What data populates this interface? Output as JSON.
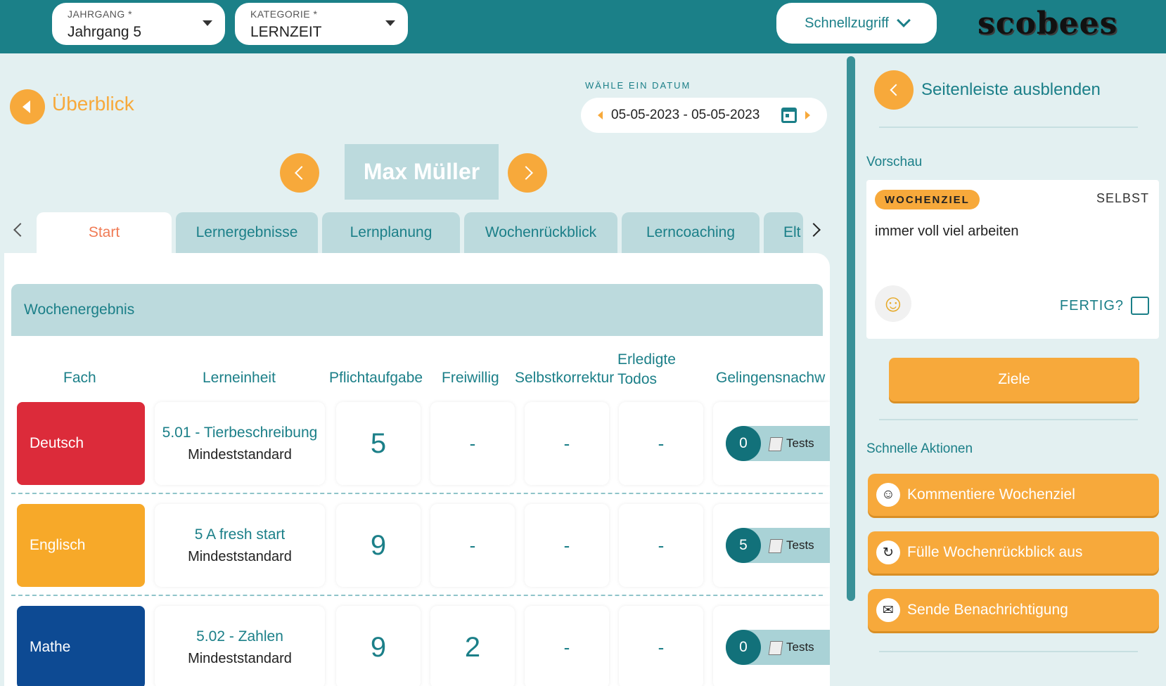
{
  "header": {
    "jahrgang": {
      "label": "JAHRGANG *",
      "value": "Jahrgang 5"
    },
    "kategorie": {
      "label": "KATEGORIE *",
      "value": "LERNZEIT"
    },
    "quick_access": "Schnellzugriff",
    "logo": "scobees"
  },
  "main": {
    "back_label": "Überblick",
    "date_label": "WÄHLE EIN DATUM",
    "date_range": "05-05-2023 - 05-05-2023",
    "student_name": "Max Müller",
    "tabs": [
      {
        "label": "Start",
        "active": true
      },
      {
        "label": "Lernergebnisse"
      },
      {
        "label": "Lernplanung"
      },
      {
        "label": "Wochenrückblick"
      },
      {
        "label": "Lerncoaching"
      },
      {
        "label": "Elt"
      }
    ],
    "section_title": "Wochenergebnis",
    "columns": [
      "Fach",
      "Lerneinheit",
      "Pflichtaufgabe",
      "Freiwillig",
      "Selbstkorrektur",
      "Erledigte Todos",
      "Gelingensnachw"
    ],
    "rows": [
      {
        "subject": "Deutsch",
        "color": "#dc2b3a",
        "unit_title": "5.01 - Tierbeschreibung",
        "unit_standard": "Mindeststandard",
        "pflicht": "5",
        "freiwillig": "-",
        "selbst": "-",
        "todos": "-",
        "tests_count": "0",
        "tests_label": "Tests"
      },
      {
        "subject": "Englisch",
        "color": "#f7a929",
        "unit_title": "5 A fresh start",
        "unit_standard": "Mindeststandard",
        "pflicht": "9",
        "freiwillig": "-",
        "selbst": "-",
        "todos": "-",
        "tests_count": "5",
        "tests_label": "Tests"
      },
      {
        "subject": "Mathe",
        "color": "#0d4a93",
        "unit_title": "5.02 - Zahlen",
        "unit_standard": "Mindeststandard",
        "pflicht": "9",
        "freiwillig": "2",
        "selbst": "-",
        "todos": "-",
        "tests_count": "0",
        "tests_label": "Tests"
      }
    ]
  },
  "sidebar": {
    "hide_label": "Seitenleiste ausblenden",
    "preview_title": "Vorschau",
    "badge": "WOCHENZIEL",
    "selbst": "SELBST",
    "goal_text": "immer voll viel arbeiten",
    "fertig": "FERTIG?",
    "ziele_button": "Ziele",
    "quick_actions_title": "Schnelle Aktionen",
    "actions": [
      {
        "label": "Kommentiere Wochenziel",
        "icon": "smiley-icon"
      },
      {
        "label": "Fülle Wochenrückblick aus",
        "icon": "refresh-icon"
      },
      {
        "label": "Sende Benachrichtigung",
        "icon": "chat-icon"
      }
    ]
  }
}
